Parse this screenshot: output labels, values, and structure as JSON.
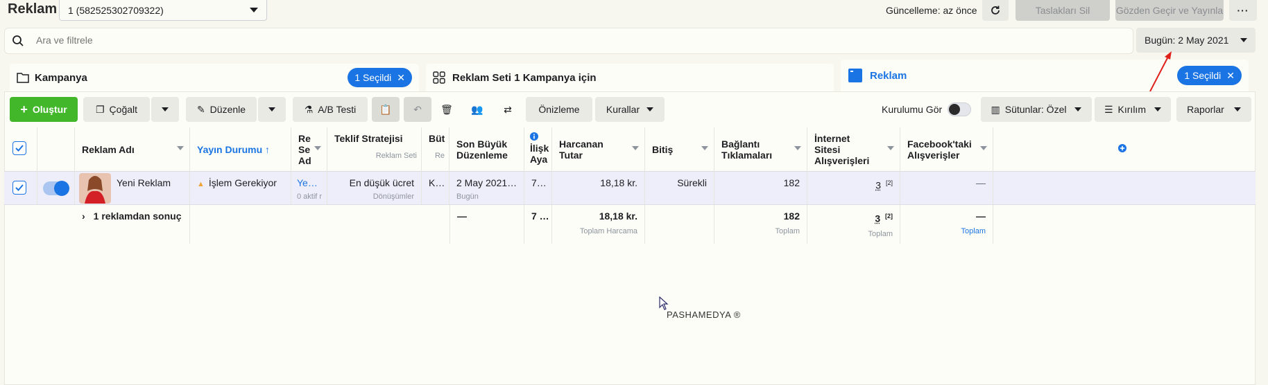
{
  "app": {
    "title": "Reklam"
  },
  "account": {
    "label": "1 (582525302709322)"
  },
  "header": {
    "update_status": "Güncelleme: az önce",
    "delete_drafts": "Taslakları Sil",
    "review_publish": "Gözden Geçir ve Yayınla"
  },
  "search": {
    "placeholder": "Ara ve filtrele"
  },
  "date_range": {
    "label": "Bugün: 2 May 2021"
  },
  "tabs": {
    "campaign": {
      "label": "Kampanya",
      "selected": "1 Seçildi"
    },
    "adset": {
      "label": "Reklam Seti 1 Kampanya için"
    },
    "ad": {
      "label": "Reklam",
      "selected": "1 Seçildi"
    }
  },
  "toolbar": {
    "create": "Oluştur",
    "duplicate": "Çoğalt",
    "edit": "Düzenle",
    "ab_test": "A/B Testi",
    "preview": "Önizleme",
    "rules": "Kurallar",
    "show_setup": "Kurulumu Gör",
    "columns": "Sütunlar: Özel",
    "breakdown": "Kırılım",
    "reports": "Raporlar"
  },
  "table": {
    "headers": {
      "ad_name": "Reklam Adı",
      "delivery": "Yayın Durumu ↑",
      "adset_name_l1": "Re",
      "adset_name_l2": "Se",
      "adset_name_l3": "Ad",
      "bid_strategy": "Teklif Stratejisi",
      "bid_strategy_sub": "Reklam Seti",
      "budget": "Büt",
      "budget_sub": "Re",
      "last_edit_l1": "Son Büyük",
      "last_edit_l2": "Düzenleme",
      "attribution_l1": "İlişk",
      "attribution_l2": "Aya",
      "spend_l1": "Harcanan",
      "spend_l2": "Tutar",
      "ends": "Bitiş",
      "link_clicks_l1": "Bağlantı",
      "link_clicks_l2": "Tıklamaları",
      "web_purchases_l1": "İnternet",
      "web_purchases_l2": "Sitesi",
      "web_purchases_l3": "Alışverişleri",
      "fb_purchases_l1": "Facebook'taki",
      "fb_purchases_l2": "Alışverişler"
    },
    "row": {
      "ad_name": "Yeni Reklam",
      "delivery": "İşlem Gerekiyor",
      "adset_name": "Ye…",
      "adset_sub": "0 aktif r",
      "bid_strategy": "En düşük ücret",
      "bid_strategy_sub": "Dönüşümler",
      "budget": "K…",
      "last_edit": "2 May 2021…",
      "last_edit_sub": "Bugün",
      "attribution": "7…",
      "spend": "18,18 kr.",
      "ends": "Sürekli",
      "link_clicks": "182",
      "web_purchases": "3",
      "web_purchases_sup": "[2]",
      "fb_purchases": "—"
    },
    "summary": {
      "label": "1 reklamdan sonuç",
      "last_edit": "—",
      "attribution": "7 …",
      "spend": "18,18 kr.",
      "spend_sub": "Toplam Harcama",
      "link_clicks": "182",
      "link_clicks_sub": "Toplam",
      "web_purchases": "3",
      "web_purchases_sup": "[2]",
      "web_purchases_sub": "Toplam",
      "fb_purchases": "—",
      "fb_purchases_sub": "Toplam"
    }
  },
  "watermark": "PASHAMEDYA ®",
  "colors": {
    "accent": "#1b74e4",
    "create": "#42b72a",
    "warning": "#f1a33b",
    "annotation": "#e0201b"
  }
}
